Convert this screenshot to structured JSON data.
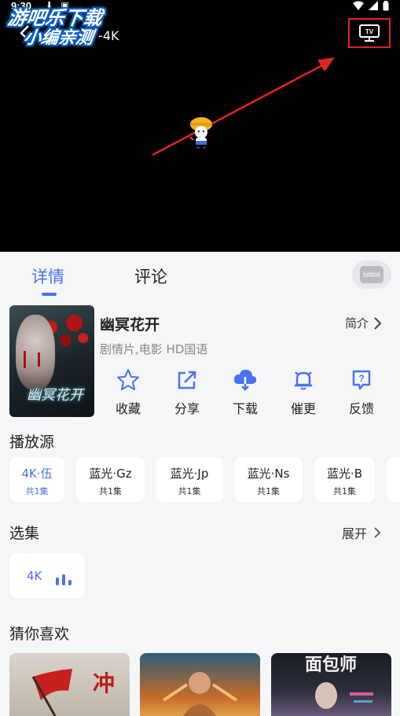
{
  "status_bar": {
    "time": "9:30"
  },
  "player": {
    "video_title": "幽冥花开 -4K",
    "watermark_line1": "游吧乐下载",
    "watermark_line2": "小编亲测",
    "tv_label": "TV"
  },
  "tabs": [
    {
      "label": "详情"
    },
    {
      "label": "评论"
    }
  ],
  "bili_label": "bilibili",
  "movie": {
    "title": "幽冥花开",
    "poster_title": "幽冥花开",
    "intro_label": "简介",
    "meta": "剧情片,电影 HD国语"
  },
  "actions": [
    {
      "label": "收藏",
      "icon": "star-icon"
    },
    {
      "label": "分享",
      "icon": "share-icon"
    },
    {
      "label": "下载",
      "icon": "cloud-download-icon"
    },
    {
      "label": "催更",
      "icon": "bell-icon"
    },
    {
      "label": "反馈",
      "icon": "feedback-icon"
    }
  ],
  "sources_title": "播放源",
  "sources": [
    {
      "name": "4K·伍",
      "count": "共1集",
      "selected": true
    },
    {
      "name": "蓝光·Gz",
      "count": "共1集"
    },
    {
      "name": "蓝光·Jp",
      "count": "共1集"
    },
    {
      "name": "蓝光·Ns",
      "count": "共1集"
    },
    {
      "name": "蓝光·B",
      "count": "共1集"
    }
  ],
  "episodes_title": "选集",
  "expand_label": "展开",
  "episodes": [
    {
      "label": "4K"
    }
  ],
  "recommend_title": "猜你喜欢",
  "recommend_texts": [
    "冲",
    "面包师"
  ],
  "colors": {
    "accent": "#4a73f0",
    "highlight_box": "#e02424"
  }
}
